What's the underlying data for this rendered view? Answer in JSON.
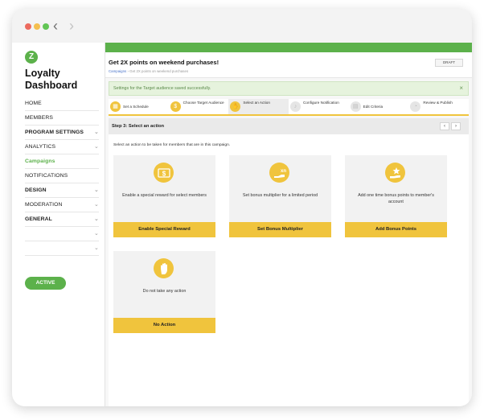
{
  "sidebar": {
    "logo": "Z",
    "title": "Loyalty Dashboard",
    "menu": [
      {
        "label": "HOME",
        "bold": false,
        "chevron": false
      },
      {
        "label": "MEMBERS",
        "bold": false,
        "chevron": false
      },
      {
        "label": "PROGRAM SETTINGS",
        "bold": true,
        "chevron": true
      },
      {
        "label": "ANALYTICS",
        "bold": false,
        "chevron": true
      },
      {
        "label": "Campaigns",
        "bold": true,
        "chevron": false,
        "active": true
      },
      {
        "label": "NOTIFICATIONS",
        "bold": false,
        "chevron": false
      },
      {
        "label": "DESIGN",
        "bold": true,
        "chevron": true
      },
      {
        "label": "MODERATION",
        "bold": false,
        "chevron": true
      },
      {
        "label": "GENERAL",
        "bold": true,
        "chevron": true
      },
      {
        "label": "",
        "bold": false,
        "chevron": true
      },
      {
        "label": "",
        "bold": false,
        "chevron": true
      }
    ],
    "status": "ACTIVE"
  },
  "header": {
    "title": "Get 2X points on weekend purchases!",
    "breadcrumb_link": "Campaigns",
    "breadcrumb_sep": "›",
    "breadcrumb_current": "Get 2X points on weekend purchases",
    "badge": "DRAFT"
  },
  "alert": {
    "message": "Settings for the Target audience saved successfully.",
    "close": "×"
  },
  "steps": [
    {
      "label": "Set a Schedule",
      "icon": "calendar-icon"
    },
    {
      "label": "Choose Target Audience",
      "icon": "dollar-icon"
    },
    {
      "label": "Select an Action",
      "icon": "hand-icon",
      "current": true
    },
    {
      "label": "Configure Notification",
      "icon": "bell-icon"
    },
    {
      "label": "Edit Criteria",
      "icon": "document-icon"
    },
    {
      "label": "Review & Publish",
      "icon": "gauge-icon"
    }
  ],
  "step_header": {
    "title": "Step 3: Select an action",
    "prev": "‹",
    "next": "›"
  },
  "instruction": "Select an action to be taken for members that are in this campaign.",
  "cards": [
    {
      "icon": "reward-ticket-icon",
      "desc": "Enable a special reward for select members",
      "button": "Enable Special Reward"
    },
    {
      "icon": "multiplier-hand-icon",
      "desc": "Set bonus multiplier for a limited period",
      "button": "Set Bonus Multiplier"
    },
    {
      "icon": "star-hand-icon",
      "desc": "Add one time bonus points to member's account",
      "button": "Add Bonus Points"
    },
    {
      "icon": "stop-hand-icon",
      "desc": "Do not take any action",
      "button": "No Action"
    }
  ],
  "colors": {
    "brand_green": "#5cb14b",
    "accent_yellow": "#f0c43d",
    "alert_bg": "#e6f3dd"
  }
}
